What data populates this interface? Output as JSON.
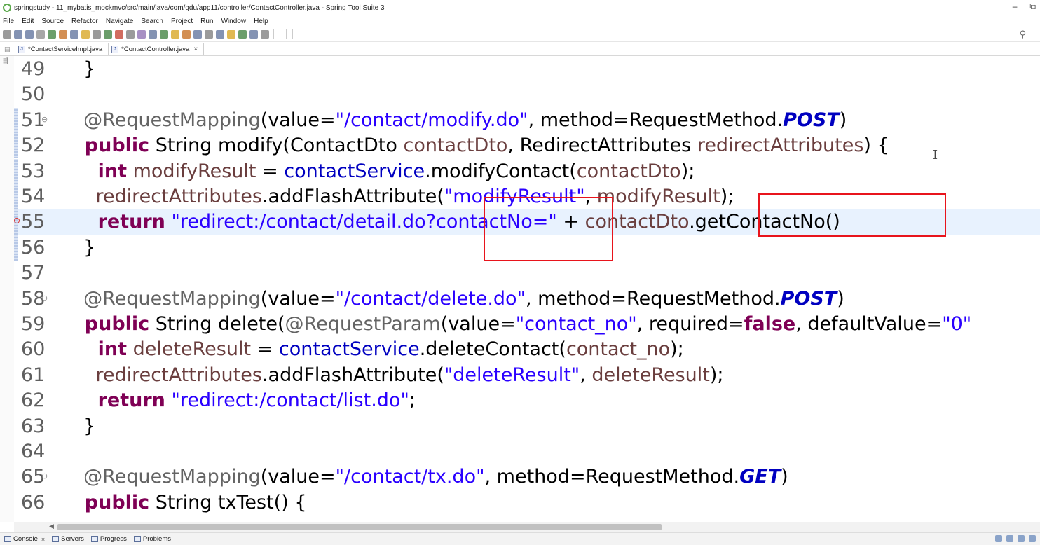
{
  "window": {
    "title": "springstudy - 11_mybatis_mockmvc/src/main/java/com/gdu/app11/controller/ContactController.java - Spring Tool Suite 3",
    "minimize": "–",
    "restore": "⧉"
  },
  "menu": [
    "File",
    "Edit",
    "Source",
    "Refactor",
    "Navigate",
    "Search",
    "Project",
    "Run",
    "Window",
    "Help"
  ],
  "editor_tabs": [
    {
      "label": "*ContactServiceImpl.java",
      "active": false
    },
    {
      "label": "*ContactController.java",
      "active": true,
      "close": "×"
    }
  ],
  "code_lines": [
    {
      "num": "49",
      "fold": "",
      "change": false,
      "error": false,
      "current": false,
      "tokens": [
        {
          "t": "  }",
          "c": "plain"
        }
      ]
    },
    {
      "num": "50",
      "fold": "",
      "change": false,
      "error": false,
      "current": false,
      "tokens": []
    },
    {
      "num": "51",
      "fold": "⊖",
      "change": true,
      "error": false,
      "current": false,
      "tokens": [
        {
          "t": "  @RequestMapping",
          "c": "ann"
        },
        {
          "t": "(value=",
          "c": "plain"
        },
        {
          "t": "\"/contact/modify.do\"",
          "c": "str"
        },
        {
          "t": ", method=RequestMethod.",
          "c": "plain"
        },
        {
          "t": "POST",
          "c": "const"
        },
        {
          "t": ")",
          "c": "plain"
        }
      ]
    },
    {
      "num": "52",
      "fold": "",
      "change": true,
      "error": false,
      "current": false,
      "tokens": [
        {
          "t": "  public",
          "c": "kw"
        },
        {
          "t": " String modify(ContactDto ",
          "c": "plain"
        },
        {
          "t": "contactDto",
          "c": "var"
        },
        {
          "t": ", RedirectAttributes ",
          "c": "plain"
        },
        {
          "t": "redirectAttributes",
          "c": "var"
        },
        {
          "t": ") {",
          "c": "plain"
        }
      ]
    },
    {
      "num": "53",
      "fold": "",
      "change": true,
      "error": false,
      "current": false,
      "tokens": [
        {
          "t": "    int",
          "c": "kw"
        },
        {
          "t": " ",
          "c": "plain"
        },
        {
          "t": "modifyResult",
          "c": "var"
        },
        {
          "t": " = ",
          "c": "plain"
        },
        {
          "t": "contactService",
          "c": "fld"
        },
        {
          "t": ".modifyContact(",
          "c": "plain"
        },
        {
          "t": "contactDto",
          "c": "var"
        },
        {
          "t": ");",
          "c": "plain"
        }
      ]
    },
    {
      "num": "54",
      "fold": "",
      "change": true,
      "error": false,
      "current": false,
      "tokens": [
        {
          "t": "    ",
          "c": "plain"
        },
        {
          "t": "redirectAttributes",
          "c": "var"
        },
        {
          "t": ".addFlashAttribute(",
          "c": "plain"
        },
        {
          "t": "\"modifyResult\"",
          "c": "str"
        },
        {
          "t": ", ",
          "c": "plain"
        },
        {
          "t": "modifyResult",
          "c": "var"
        },
        {
          "t": ");",
          "c": "plain"
        }
      ]
    },
    {
      "num": "55",
      "fold": "",
      "change": true,
      "error": true,
      "current": true,
      "tokens": [
        {
          "t": "    return",
          "c": "kw"
        },
        {
          "t": " ",
          "c": "plain"
        },
        {
          "t": "\"redirect:/contact/detail.do?contactNo=\"",
          "c": "str"
        },
        {
          "t": " + ",
          "c": "plain"
        },
        {
          "t": "contactDto",
          "c": "var"
        },
        {
          "t": ".getContactNo()",
          "c": "plain"
        }
      ]
    },
    {
      "num": "56",
      "fold": "",
      "change": true,
      "error": false,
      "current": false,
      "tokens": [
        {
          "t": "  }",
          "c": "plain"
        }
      ]
    },
    {
      "num": "57",
      "fold": "",
      "change": false,
      "error": false,
      "current": false,
      "tokens": []
    },
    {
      "num": "58",
      "fold": "⊖",
      "change": false,
      "error": false,
      "current": false,
      "tokens": [
        {
          "t": "  @RequestMapping",
          "c": "ann"
        },
        {
          "t": "(value=",
          "c": "plain"
        },
        {
          "t": "\"/contact/delete.do\"",
          "c": "str"
        },
        {
          "t": ", method=RequestMethod.",
          "c": "plain"
        },
        {
          "t": "POST",
          "c": "const"
        },
        {
          "t": ")",
          "c": "plain"
        }
      ]
    },
    {
      "num": "59",
      "fold": "",
      "change": false,
      "error": false,
      "current": false,
      "tokens": [
        {
          "t": "  public",
          "c": "kw"
        },
        {
          "t": " String delete(",
          "c": "plain"
        },
        {
          "t": "@RequestParam",
          "c": "ann"
        },
        {
          "t": "(value=",
          "c": "plain"
        },
        {
          "t": "\"contact_no\"",
          "c": "str"
        },
        {
          "t": ", required=",
          "c": "plain"
        },
        {
          "t": "false",
          "c": "kw"
        },
        {
          "t": ", defaultValue=",
          "c": "plain"
        },
        {
          "t": "\"0\"",
          "c": "str"
        }
      ]
    },
    {
      "num": "60",
      "fold": "",
      "change": false,
      "error": false,
      "current": false,
      "tokens": [
        {
          "t": "    int",
          "c": "kw"
        },
        {
          "t": " ",
          "c": "plain"
        },
        {
          "t": "deleteResult",
          "c": "var"
        },
        {
          "t": " = ",
          "c": "plain"
        },
        {
          "t": "contactService",
          "c": "fld"
        },
        {
          "t": ".deleteContact(",
          "c": "plain"
        },
        {
          "t": "contact_no",
          "c": "var"
        },
        {
          "t": ");",
          "c": "plain"
        }
      ]
    },
    {
      "num": "61",
      "fold": "",
      "change": false,
      "error": false,
      "current": false,
      "tokens": [
        {
          "t": "    ",
          "c": "plain"
        },
        {
          "t": "redirectAttributes",
          "c": "var"
        },
        {
          "t": ".addFlashAttribute(",
          "c": "plain"
        },
        {
          "t": "\"deleteResult\"",
          "c": "str"
        },
        {
          "t": ", ",
          "c": "plain"
        },
        {
          "t": "deleteResult",
          "c": "var"
        },
        {
          "t": ");",
          "c": "plain"
        }
      ]
    },
    {
      "num": "62",
      "fold": "",
      "change": false,
      "error": false,
      "current": false,
      "tokens": [
        {
          "t": "    return",
          "c": "kw"
        },
        {
          "t": " ",
          "c": "plain"
        },
        {
          "t": "\"redirect:/contact/list.do\"",
          "c": "str"
        },
        {
          "t": ";",
          "c": "plain"
        }
      ]
    },
    {
      "num": "63",
      "fold": "",
      "change": false,
      "error": false,
      "current": false,
      "tokens": [
        {
          "t": "  }",
          "c": "plain"
        }
      ]
    },
    {
      "num": "64",
      "fold": "",
      "change": false,
      "error": false,
      "current": false,
      "tokens": []
    },
    {
      "num": "65",
      "fold": "⊖",
      "change": false,
      "error": false,
      "current": false,
      "tokens": [
        {
          "t": "  @RequestMapping",
          "c": "ann"
        },
        {
          "t": "(value=",
          "c": "plain"
        },
        {
          "t": "\"/contact/tx.do\"",
          "c": "str"
        },
        {
          "t": ", method=RequestMethod.",
          "c": "plain"
        },
        {
          "t": "GET",
          "c": "const"
        },
        {
          "t": ")",
          "c": "plain"
        }
      ]
    },
    {
      "num": "66",
      "fold": "",
      "change": false,
      "error": false,
      "current": false,
      "tokens": [
        {
          "t": "  public",
          "c": "kw"
        },
        {
          "t": " String txTest() {",
          "c": "plain"
        }
      ]
    }
  ],
  "bottom_tabs": [
    {
      "label": "Console",
      "close": "×"
    },
    {
      "label": "Servers"
    },
    {
      "label": "Progress"
    },
    {
      "label": "Problems"
    }
  ],
  "colors": {
    "keyword": "#7f0055",
    "string": "#2a00ff",
    "annotation": "#646464",
    "highlight_box": "#e8141c",
    "current_line": "#e8f2fe"
  }
}
